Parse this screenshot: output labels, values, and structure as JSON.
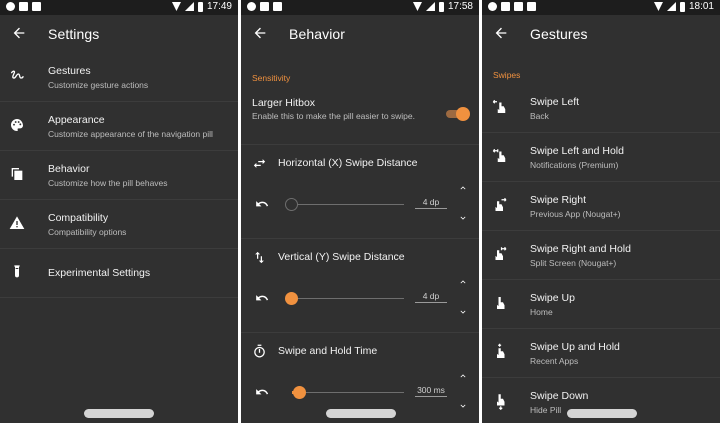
{
  "colors": {
    "background": "#303030",
    "statusbar": "#1d1d1d",
    "accent": "#f0913f",
    "divider": "#3c3c3c"
  },
  "status_times": [
    "17:49",
    "17:58",
    "18:01"
  ],
  "settings": {
    "title": "Settings",
    "items": [
      {
        "title": "Gestures",
        "subtitle": "Customize gesture actions",
        "icon": "gesture-icon"
      },
      {
        "title": "Appearance",
        "subtitle": "Customize appearance of the navigation pill",
        "icon": "palette-icon"
      },
      {
        "title": "Behavior",
        "subtitle": "Customize how the pill behaves",
        "icon": "copy-icon"
      },
      {
        "title": "Compatibility",
        "subtitle": "Compatibility options",
        "icon": "warning-icon"
      },
      {
        "title": "Experimental Settings",
        "subtitle": "",
        "icon": "test-tube-icon"
      }
    ]
  },
  "behavior": {
    "title": "Behavior",
    "section": "Sensitivity",
    "hitbox": {
      "title": "Larger Hitbox",
      "description": "Enable this to make the pill easier to swipe.",
      "enabled": true
    },
    "prefs": [
      {
        "label": "Horizontal (X) Swipe Distance",
        "value": "4 dp",
        "fraction": 0.0,
        "icon": "swap-horizontal-icon"
      },
      {
        "label": "Vertical (Y) Swipe Distance",
        "value": "4 dp",
        "fraction": 0.0,
        "icon": "swap-vertical-icon"
      },
      {
        "label": "Swipe and Hold Time",
        "value": "300 ms",
        "fraction": 0.06,
        "icon": "timer-icon"
      }
    ]
  },
  "gestures": {
    "title": "Gestures",
    "section": "Swipes",
    "items": [
      {
        "title": "Swipe Left",
        "subtitle": "Back",
        "icon": "swipe-left-icon"
      },
      {
        "title": "Swipe Left and Hold",
        "subtitle": "Notifications (Premium)",
        "icon": "swipe-left-hold-icon"
      },
      {
        "title": "Swipe Right",
        "subtitle": "Previous App (Nougat+)",
        "icon": "swipe-right-icon"
      },
      {
        "title": "Swipe Right and Hold",
        "subtitle": "Split Screen (Nougat+)",
        "icon": "swipe-right-hold-icon"
      },
      {
        "title": "Swipe Up",
        "subtitle": "Home",
        "icon": "swipe-up-icon"
      },
      {
        "title": "Swipe Up and Hold",
        "subtitle": "Recent Apps",
        "icon": "swipe-up-hold-icon"
      },
      {
        "title": "Swipe Down",
        "subtitle": "Hide Pill",
        "icon": "swipe-down-icon"
      }
    ]
  }
}
